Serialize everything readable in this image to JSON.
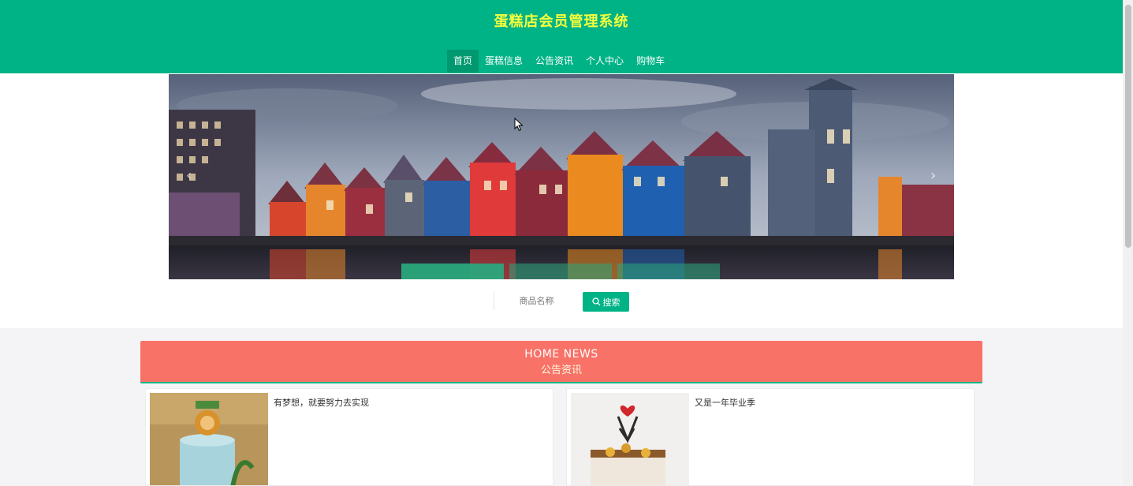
{
  "header": {
    "title": "蛋糕店会员管理系统",
    "nav": [
      {
        "label": "首页",
        "active": true
      },
      {
        "label": "蛋糕信息",
        "active": false
      },
      {
        "label": "公告资讯",
        "active": false
      },
      {
        "label": "个人中心",
        "active": false
      },
      {
        "label": "购物车",
        "active": false
      }
    ]
  },
  "carousel": {
    "prev_icon": "‹",
    "next_icon": "›",
    "slide_count": 3,
    "active_index": 0
  },
  "search": {
    "placeholder": "商品名称",
    "button_label": "搜索"
  },
  "news": {
    "heading_en": "HOME NEWS",
    "heading_cn": "公告资讯",
    "items": [
      {
        "title": "有梦想，就要努力去实现"
      },
      {
        "title": "又是一年毕业季"
      }
    ]
  },
  "colors": {
    "primary": "#00b386",
    "title": "#f7ff3d",
    "news_bg": "#f87268"
  }
}
